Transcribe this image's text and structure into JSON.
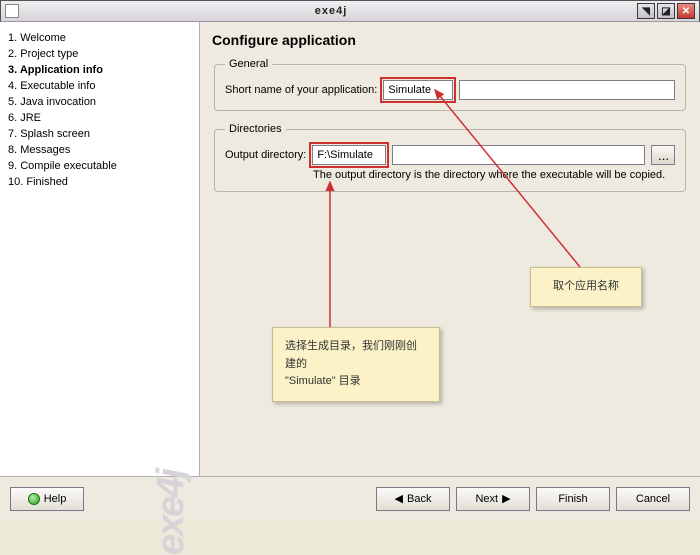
{
  "window": {
    "title": "exe4j"
  },
  "brand": "exe4j",
  "steps": [
    {
      "label": "1. Welcome",
      "active": false
    },
    {
      "label": "2. Project type",
      "active": false
    },
    {
      "label": "3. Application info",
      "active": true
    },
    {
      "label": "4. Executable info",
      "active": false
    },
    {
      "label": "5. Java invocation",
      "active": false
    },
    {
      "label": "6. JRE",
      "active": false
    },
    {
      "label": "7. Splash screen",
      "active": false
    },
    {
      "label": "8. Messages",
      "active": false
    },
    {
      "label": "9. Compile executable",
      "active": false
    },
    {
      "label": "10. Finished",
      "active": false
    }
  ],
  "page": {
    "title": "Configure application",
    "general": {
      "legend": "General",
      "short_name_label": "Short name of your application:",
      "short_name_value": "Simulate"
    },
    "directories": {
      "legend": "Directories",
      "output_label": "Output directory:",
      "output_value": "F:\\Simulate",
      "browse_label": "...",
      "hint": "The output directory is the directory where the executable will be copied."
    }
  },
  "callouts": {
    "name_tip": "取个应用名称",
    "dir_tip": "选择生成目录，我们刚刚创建的\n\"Simulate\" 目录"
  },
  "footer": {
    "help": "Help",
    "back": "Back",
    "next": "Next",
    "finish": "Finish",
    "cancel": "Cancel"
  }
}
